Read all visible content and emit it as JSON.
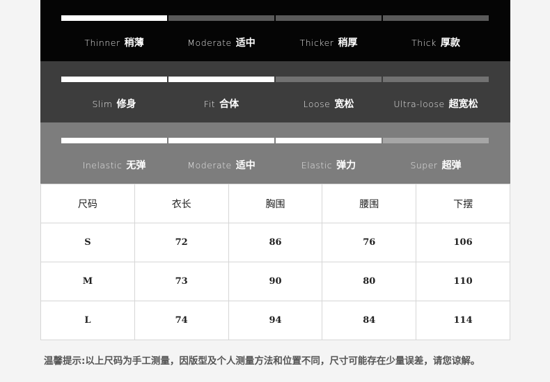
{
  "colors": {
    "bar_active": "#ffffff",
    "bar_inactive_dark": "#5a5a5a",
    "bar_inactive_mid": "#727272",
    "bar_inactive_light": "#a6a6a6"
  },
  "scales": [
    {
      "name": "thickness",
      "selected_index": 0,
      "options": [
        {
          "en": "Thinner",
          "cn": "稍薄"
        },
        {
          "en": "Moderate",
          "cn": "适中"
        },
        {
          "en": "Thicker",
          "cn": "稍厚"
        },
        {
          "en": "Thick",
          "cn": "厚款"
        }
      ]
    },
    {
      "name": "fit",
      "selected_index": 1,
      "options": [
        {
          "en": "Slim",
          "cn": "修身"
        },
        {
          "en": "Fit",
          "cn": "合体"
        },
        {
          "en": "Loose",
          "cn": "宽松"
        },
        {
          "en": "Ultra-loose",
          "cn": "超宽松"
        }
      ]
    },
    {
      "name": "elasticity",
      "selected_index": 2,
      "options": [
        {
          "en": "Inelastic",
          "cn": "无弹"
        },
        {
          "en": "Moderate",
          "cn": "适中"
        },
        {
          "en": "Elastic",
          "cn": "弹力"
        },
        {
          "en": "Super",
          "cn": "超弹"
        }
      ]
    }
  ],
  "size_table": {
    "headers": [
      "尺码",
      "衣长",
      "胸围",
      "腰围",
      "下摆"
    ],
    "rows": [
      [
        "S",
        "72",
        "86",
        "76",
        "106"
      ],
      [
        "M",
        "73",
        "90",
        "80",
        "110"
      ],
      [
        "L",
        "74",
        "94",
        "84",
        "114"
      ]
    ]
  },
  "note": "温馨提示:以上尺码为手工测量，因版型及个人测量方法和位置不同，尺寸可能存在少量误差，请您谅解。"
}
